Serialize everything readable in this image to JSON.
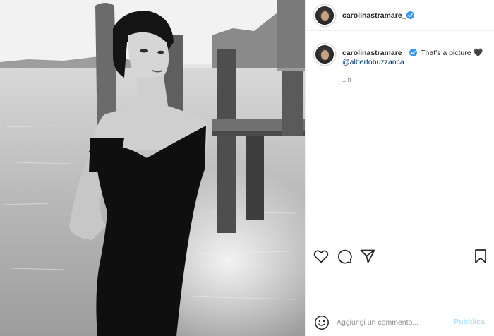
{
  "post": {
    "author": "carolinastramare_",
    "verified": true,
    "caption_author": "carolinastramare_",
    "caption_text": "That's a picture",
    "caption_emoji": "black-heart",
    "caption_emoji_glyph": "🖤",
    "mention": "@albertobuzzanca",
    "time_ago": "1 h"
  },
  "photo": {
    "description_icon": "photo",
    "tone": "black-and-white"
  },
  "actions": {
    "like_icon": "heart-outline-icon",
    "comment_icon": "comment-bubble-icon",
    "share_icon": "paper-plane-icon",
    "save_icon": "bookmark-icon"
  },
  "comment_box": {
    "placeholder": "Aggiungi un commento...",
    "value": "",
    "publish_label": "Pubblica"
  },
  "colors": {
    "verified_blue": "#3897f0",
    "mention_blue": "#00376b",
    "publish_disabled": "#b2dffc",
    "text": "#262626",
    "muted": "#8e8e8e"
  }
}
